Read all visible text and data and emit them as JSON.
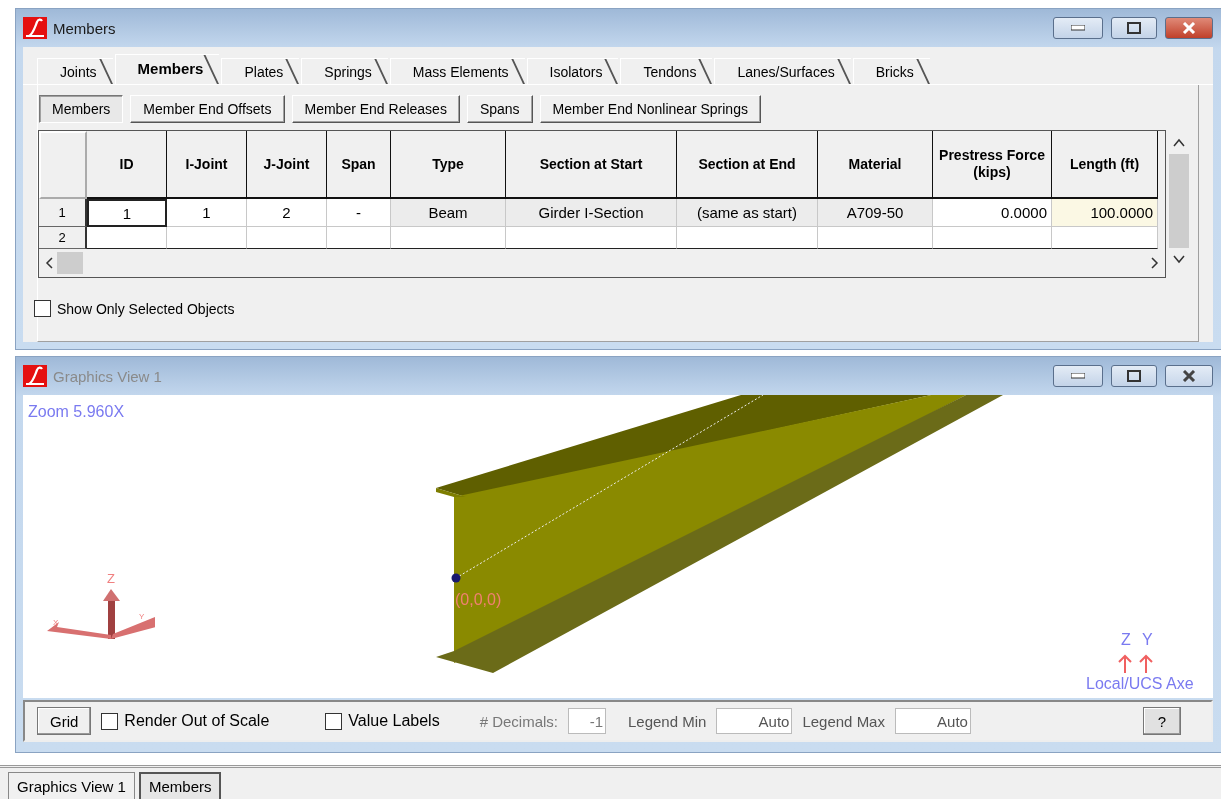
{
  "members_window": {
    "title": "Members",
    "active": true,
    "tabs": [
      {
        "label": "Joints",
        "selected": false
      },
      {
        "label": "Members",
        "selected": true
      },
      {
        "label": "Plates",
        "selected": false
      },
      {
        "label": "Springs",
        "selected": false
      },
      {
        "label": "Mass Elements",
        "selected": false
      },
      {
        "label": "Isolators",
        "selected": false
      },
      {
        "label": "Tendons",
        "selected": false
      },
      {
        "label": "Lanes/Surfaces",
        "selected": false
      },
      {
        "label": "Bricks",
        "selected": false
      }
    ],
    "subtabs": [
      {
        "label": "Members",
        "selected": true
      },
      {
        "label": "Member End Offsets",
        "selected": false
      },
      {
        "label": "Member End Releases",
        "selected": false
      },
      {
        "label": "Spans",
        "selected": false
      },
      {
        "label": "Member End Nonlinear Springs",
        "selected": false
      }
    ],
    "table": {
      "columns": [
        "ID",
        "I-Joint",
        "J-Joint",
        "Span",
        "Type",
        "Section at Start",
        "Section at End",
        "Material",
        "Prestress Force (kips)",
        "Length (ft)"
      ],
      "rows": [
        {
          "header": "1",
          "cells": [
            {
              "text": "1",
              "kind": "input",
              "focused": true
            },
            {
              "text": "1",
              "kind": "input",
              "focused": false
            },
            {
              "text": "2",
              "kind": "input",
              "focused": false
            },
            {
              "text": "-",
              "kind": "input",
              "focused": false
            },
            {
              "text": "Beam",
              "kind": "readonly",
              "focused": false
            },
            {
              "text": "Girder I-Section",
              "kind": "readonly",
              "focused": false
            },
            {
              "text": "(same as start)",
              "kind": "readonly",
              "focused": false
            },
            {
              "text": "A709-50",
              "kind": "readonly",
              "focused": false
            },
            {
              "text": "0.0000",
              "kind": "number",
              "focused": false
            },
            {
              "text": "100.0000",
              "kind": "computed",
              "focused": false
            }
          ]
        },
        {
          "header": "2",
          "cells": []
        }
      ]
    },
    "show_only_selected": {
      "label": "Show Only Selected Objects",
      "checked": false
    }
  },
  "graphics_window": {
    "title": "Graphics View 1",
    "active": false,
    "zoom_label": "Zoom  5.960X",
    "origin_label": "(0,0,0)",
    "triad_labels": [
      "Z",
      "X",
      "Y"
    ],
    "local_axes": {
      "labels": [
        "Z",
        "Y"
      ],
      "caption": "Local/UCS Axe"
    },
    "toolbar": {
      "grid_button": "Grid",
      "checkboxes": [
        {
          "label": "Render Out of Scale",
          "checked": false
        },
        {
          "label": "Value Labels",
          "checked": false
        }
      ],
      "decimals": {
        "label": "# Decimals:",
        "value": "-1",
        "disabled": true
      },
      "legend_min": {
        "label": "Legend Min",
        "value": "Auto"
      },
      "legend_max": {
        "label": "Legend Max",
        "value": "Auto"
      },
      "help_button": "?"
    }
  },
  "bottom_tabs": [
    {
      "label": "Graphics View 1",
      "selected": false
    },
    {
      "label": "Members",
      "selected": true
    }
  ]
}
